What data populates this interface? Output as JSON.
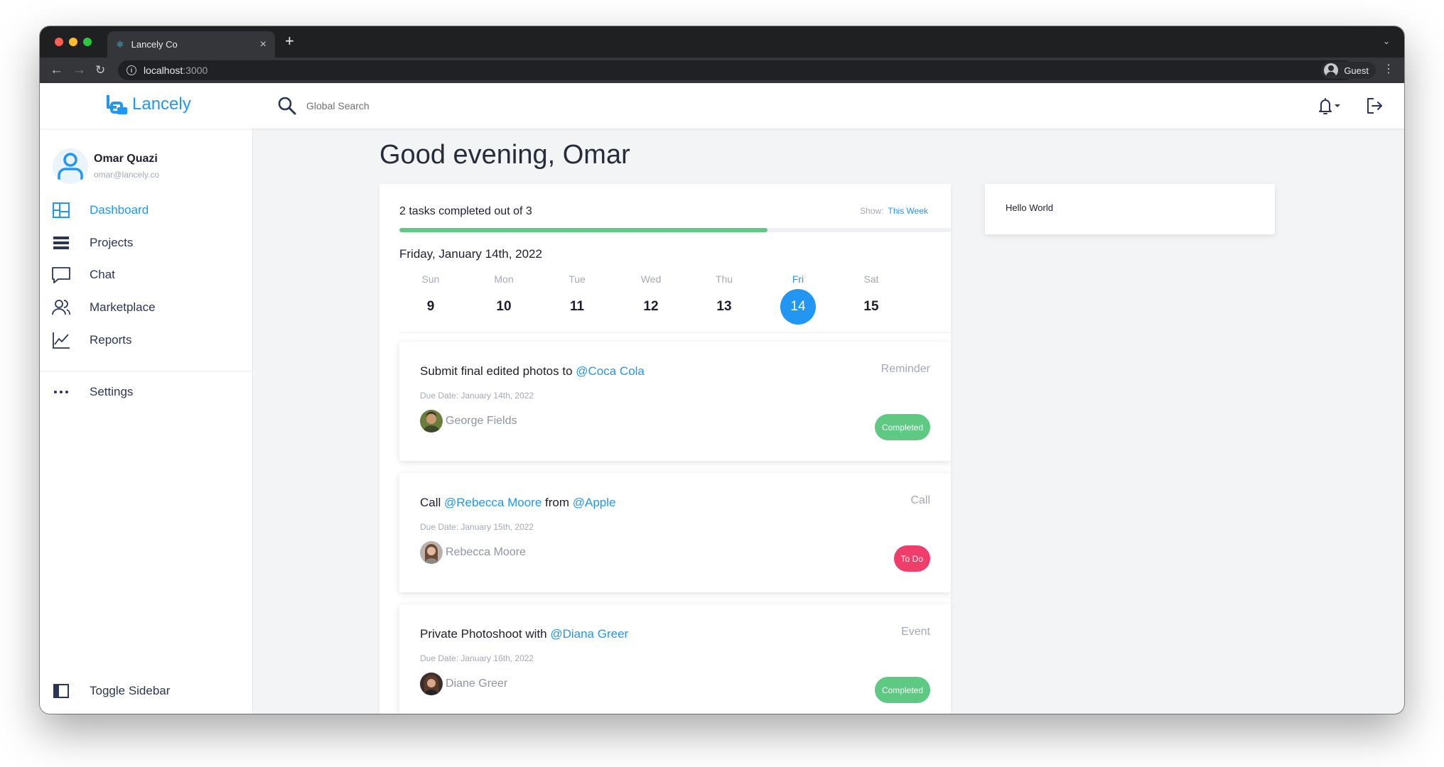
{
  "browser": {
    "tab_title": "Lancely Co",
    "url_host": "localhost",
    "url_port": ":3000",
    "profile_label": "Guest"
  },
  "header": {
    "logo_text": "Lancely",
    "search_label": "Global Search"
  },
  "sidebar": {
    "user_name": "Omar Quazi",
    "user_email": "omar@lancely.co",
    "items": [
      {
        "label": "Dashboard",
        "icon": "dashboard-icon",
        "active": true
      },
      {
        "label": "Projects",
        "icon": "projects-icon",
        "active": false
      },
      {
        "label": "Chat",
        "icon": "chat-icon",
        "active": false
      },
      {
        "label": "Marketplace",
        "icon": "marketplace-icon",
        "active": false
      },
      {
        "label": "Reports",
        "icon": "reports-icon",
        "active": false
      }
    ],
    "settings_label": "Settings",
    "toggle_label": "Toggle Sidebar"
  },
  "main": {
    "greeting": "Good evening, Omar",
    "task_count": "2 tasks completed out of 3",
    "show_prefix": "Show:",
    "show_value": "This Week",
    "progress": 0.667,
    "date_heading": "Friday, January 14th, 2022",
    "week": [
      {
        "name": "Sun",
        "num": "9",
        "active": false
      },
      {
        "name": "Mon",
        "num": "10",
        "active": false
      },
      {
        "name": "Tue",
        "num": "11",
        "active": false
      },
      {
        "name": "Wed",
        "num": "12",
        "active": false
      },
      {
        "name": "Thu",
        "num": "13",
        "active": false
      },
      {
        "name": "Fri",
        "num": "14",
        "active": true
      },
      {
        "name": "Sat",
        "num": "15",
        "active": false
      }
    ],
    "tasks": [
      {
        "title_parts": [
          "Submit final edited photos to ",
          "@Coca Cola"
        ],
        "type": "Reminder",
        "due": "Due Date: January 14th, 2022",
        "assignee": "George Fields",
        "status": "Completed"
      },
      {
        "title_parts": [
          "Call ",
          "@Rebecca Moore",
          " from ",
          "@Apple"
        ],
        "type": "Call",
        "due": "Due Date: January 15th, 2022",
        "assignee": "Rebecca Moore",
        "status": "To Do"
      },
      {
        "title_parts": [
          "Private Photoshoot with ",
          "@Diana Greer"
        ],
        "type": "Event",
        "due": "Due Date: January 16th, 2022",
        "assignee": "Diane Greer",
        "status": "Completed"
      }
    ]
  },
  "widget": {
    "text": "Hello World"
  },
  "colors": {
    "accent": "#2196f3",
    "completed": "#5ec983",
    "todo": "#ef3e6b"
  }
}
